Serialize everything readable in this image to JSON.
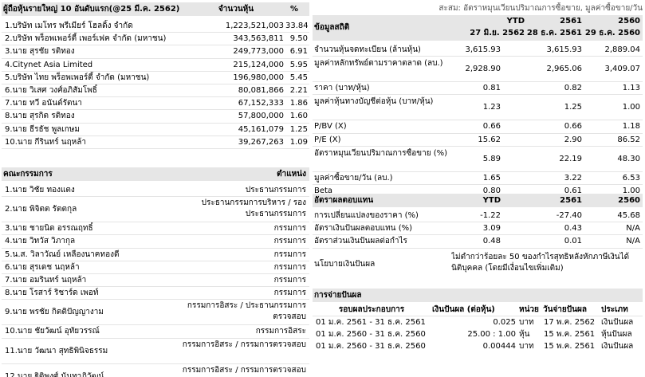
{
  "shareholders": {
    "header": {
      "name": "ผู้ถือหุ้นรายใหญ่ 10 อันดับแรก(@25 มี.ค. 2562)",
      "shares": "จำนวนหุ้น",
      "pct": "%"
    },
    "rows": [
      {
        "name": "1.บริษัท เมโทร พรีเมียร์ โฮลดิ้ง จำกัด",
        "shares": "1,223,521,003",
        "pct": "33.84"
      },
      {
        "name": "2.บริษัท พร็อพเพอร์ตี้ เพอร์เฟค จำกัด (มหาชน)",
        "shares": "343,563,811",
        "pct": "9.50"
      },
      {
        "name": "3.นาย สุรชัย รติทอง",
        "shares": "249,773,000",
        "pct": "6.91"
      },
      {
        "name": "4.Citynet Asia Limited",
        "shares": "215,124,000",
        "pct": "5.95"
      },
      {
        "name": "5.บริษัท ไทย พร็อพเพอร์ตี้ จำกัด (มหาชน)",
        "shares": "196,980,000",
        "pct": "5.45"
      },
      {
        "name": "6.นาย วิเสศ วงศ์อภิสัมโพธิ์",
        "shares": "80,081,866",
        "pct": "2.21"
      },
      {
        "name": "7.นาย ทวี อนันต์รัตนา",
        "shares": "67,152,333",
        "pct": "1.86"
      },
      {
        "name": "8.นาย สุรกิต รติทอง",
        "shares": "57,800,000",
        "pct": "1.60"
      },
      {
        "name": "9.นาย ธีรธัช พูลเกษม",
        "shares": "45,161,079",
        "pct": "1.25"
      },
      {
        "name": "10.นาย กีรินทร์ นฤหล้า",
        "shares": "39,267,263",
        "pct": "1.09"
      }
    ]
  },
  "board": {
    "header": {
      "name": "คณะกรรมการ",
      "position": "ตำแหน่ง"
    },
    "rows": [
      {
        "name": "1.นาย วิชัย ทองแตง",
        "position": "ประธานกรรมการ"
      },
      {
        "name": "2.นาย พิจิตต รัตตกุล",
        "position": "ประธานกรรมการบริหาร / รองประธานกรรมการ"
      },
      {
        "name": "3.นาย ชายนิด อรรณฤทธิ์",
        "position": "กรรมการ"
      },
      {
        "name": "4.นาย วิทวัส วิภากุล",
        "position": "กรรมการ"
      },
      {
        "name": "5.น.ส. วิลาวัณย์ เหลืองนาคทองดี",
        "position": "กรรมการ"
      },
      {
        "name": "6.นาย สุรเดช นฤหล้า",
        "position": "กรรมการ"
      },
      {
        "name": "7.นาย อมรินทร์ นฤหล้า",
        "position": "กรรมการ"
      },
      {
        "name": "8.นาย โรสาร์ ริชาร์ด เพอท์",
        "position": "กรรมการ"
      },
      {
        "name": "9.นาย พรชัย กิตติปัญญางาม",
        "position": "กรรมการอิสระ / ประธานกรรมการตรวจสอบ"
      },
      {
        "name": "10.นาย ชัยวัฒน์ อุทัยวรรณ์",
        "position": "กรรมการอิสระ"
      },
      {
        "name": "11.นาย วัฒนา สุทธิพินิจธรรม",
        "position": "กรรมการอิสระ / กรรมการตรวจสอบ"
      },
      {
        "name": "12.นาย ฐิติพงศ์ นันทาภิวัฒน์",
        "position": "กรรมการอิสระ / กรรมการตรวจสอบ"
      }
    ]
  },
  "stats": {
    "note": "สะสม: อัตราหมุนเวียนปริมาณการซื้อขาย, มูลค่าซื้อขาย/วัน",
    "title": "ข้อมูลสถิติ",
    "col_years": [
      "YTD",
      "2561",
      "2560"
    ],
    "col_dates": [
      "27 มิ.ย. 2562",
      "28 ธ.ค. 2561",
      "29 ธ.ค. 2560"
    ],
    "rows": [
      {
        "label": "จำนวนหุ้นจดทะเบียน (ล้านหุ้น)",
        "v": [
          "3,615.93",
          "3,615.93",
          "2,889.04"
        ]
      },
      {
        "label": "มูลค่าหลักทรัพย์ตามราคาตลาด (ลบ.)",
        "v": [
          "2,928.90",
          "2,965.06",
          "3,409.07"
        ]
      },
      {
        "label": "ราคา (บาท/หุ้น)",
        "v": [
          "0.81",
          "0.82",
          "1.13"
        ]
      },
      {
        "label": "มูลค่าหุ้นทางบัญชีต่อหุ้น (บาท/หุ้น)",
        "v": [
          "1.23",
          "1.25",
          "1.00"
        ]
      },
      {
        "label": "P/BV (X)",
        "v": [
          "0.66",
          "0.66",
          "1.18"
        ]
      },
      {
        "label": "P/E (X)",
        "v": [
          "15.62",
          "2.90",
          "86.52"
        ]
      },
      {
        "label": "อัตราหมุนเวียนปริมาณการซื้อขาย (%)",
        "v": [
          "5.89",
          "22.19",
          "48.30"
        ]
      },
      {
        "label": "มูลค่าซื้อขาย/วัน (ลบ.)",
        "v": [
          "1.65",
          "3.22",
          "6.53"
        ]
      },
      {
        "label": "Beta",
        "v": [
          "0.80",
          "0.61",
          "1.00"
        ]
      }
    ]
  },
  "returns": {
    "header": {
      "title": "อัตราผลตอบแทน",
      "c1": "YTD",
      "c2": "2561",
      "c3": "2560"
    },
    "rows": [
      {
        "label": "การเปลี่ยนแปลงของราคา (%)",
        "v": [
          "-1.22",
          "-27.40",
          "45.68"
        ]
      },
      {
        "label": "อัตราเงินปันผลตอบแทน (%)",
        "v": [
          "3.09",
          "0.43",
          "N/A"
        ]
      },
      {
        "label": "อัตราส่วนเงินปันผลต่อกำไร",
        "v": [
          "0.48",
          "0.01",
          "N/A"
        ]
      }
    ],
    "policy_label": "นโยบายเงินปันผล",
    "policy_text": "ไม่ต่ำกว่าร้อยละ 50 ของกำไรสุทธิหลังหักภาษีเงินได้นิติบุคคล (โดยมีเงื่อนไขเพิ่มเติม)"
  },
  "dividends": {
    "title": "การจ่ายปันผล",
    "cols": [
      "รอบผลประกอบการ",
      "เงินปันผล (ต่อหุ้น)",
      "หน่วย",
      "วันจ่ายปันผล",
      "ประเภท"
    ],
    "rows": [
      {
        "period": "01 ม.ค. 2561 - 31 ธ.ค. 2561",
        "amount": "0.025",
        "unit": "บาท",
        "date": "17 พ.ค. 2562",
        "type": "เงินปันผล"
      },
      {
        "period": "01 ม.ค. 2560 - 31 ธ.ค. 2560",
        "amount": "25.00 : 1.00",
        "unit": "หุ้น",
        "date": "15 พ.ค. 2561",
        "type": "หุ้นปันผล"
      },
      {
        "period": "01 ม.ค. 2560 - 31 ธ.ค. 2560",
        "amount": "0.00444",
        "unit": "บาท",
        "date": "15 พ.ค. 2561",
        "type": "เงินปันผล"
      }
    ]
  }
}
